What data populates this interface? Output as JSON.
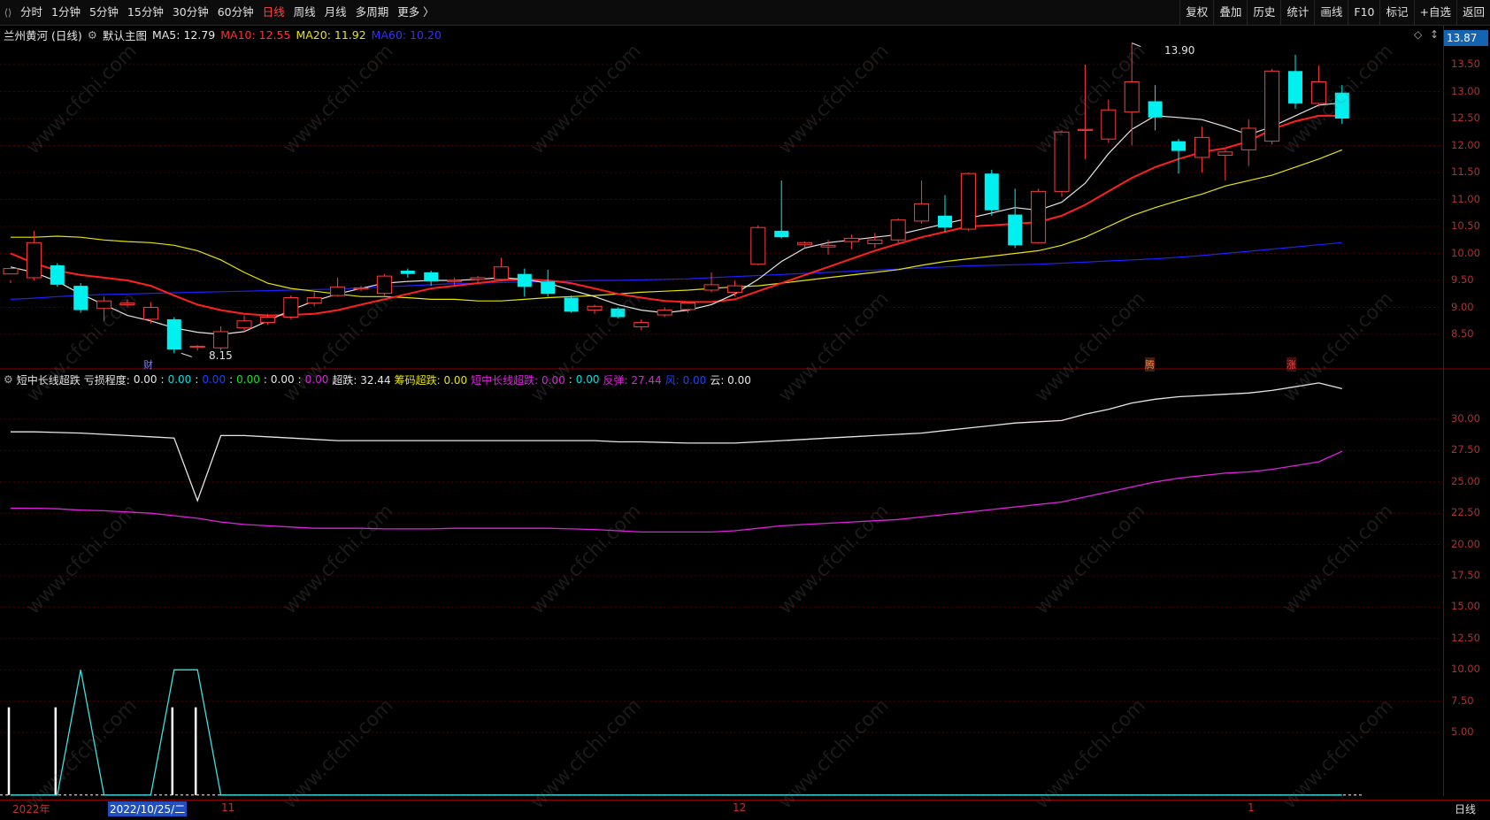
{
  "toolbar": {
    "items": [
      "分时",
      "1分钟",
      "5分钟",
      "15分钟",
      "30分钟",
      "60分钟",
      "日线",
      "周线",
      "月线",
      "多周期",
      "更多 〉"
    ],
    "active_index": 6,
    "right_items": [
      "复权",
      "叠加",
      "历史",
      "统计",
      "画线",
      "F10",
      "标记",
      "+自选",
      "返回"
    ]
  },
  "main_header": {
    "stock": "兰州黄河 (日线)",
    "template": "默认主图",
    "ma5": "MA5: 12.79",
    "ma10": "MA10: 12.55",
    "ma20": "MA20: 11.92",
    "ma60": "MA60: 10.20"
  },
  "price_tag": "13.87",
  "price_axis": [
    "13.50",
    "13.00",
    "12.50",
    "12.00",
    "11.50",
    "11.00",
    "10.50",
    "10.00",
    "9.50",
    "9.00",
    "8.50"
  ],
  "high_label": "13.90",
  "low_label": "8.15",
  "event_marks": [
    "财",
    "腾",
    "涨"
  ],
  "indicator_header": {
    "name": "短中长线超跌",
    "loss_label": "亏损程度:",
    "loss_values": [
      "0.00",
      "0.00",
      "0.00",
      "0.00",
      "0.00",
      "0.00"
    ],
    "chaodie": "超跌: 32.44",
    "chouma": "筹码超跌: 0.00",
    "dzcd": "短中长线超跌: 0.00",
    "dzcd_v2": "0.00",
    "fantan": "反弹: 27.44",
    "feng": "风: 0.00",
    "yun": "云: 0.00"
  },
  "ind_axis": [
    "30.00",
    "27.50",
    "25.00",
    "22.50",
    "20.00",
    "17.50",
    "15.00",
    "12.50",
    "10.00",
    "7.50",
    "5.00"
  ],
  "dates": {
    "year": "2022年",
    "selected": "2022/10/25/二",
    "m11": "11",
    "m12": "12",
    "m1": "1"
  },
  "period": "日线",
  "watermark": "www.cfchi.com",
  "colors": {
    "up": "#ff3c3c",
    "down": "#00f0f0",
    "ma5": "#e6e6e6",
    "ma10": "#ff2020",
    "ma20": "#e6e600",
    "ma60": "#2020ff"
  },
  "chart_data": {
    "type": "candlestick",
    "candles": [
      [
        9.62,
        9.72,
        9.5,
        9.45
      ],
      [
        9.55,
        10.2,
        10.42,
        9.5
      ],
      [
        9.78,
        9.42,
        9.82,
        9.38
      ],
      [
        9.4,
        8.95,
        9.45,
        8.9
      ],
      [
        8.98,
        9.12,
        9.2,
        8.75
      ],
      [
        9.05,
        9.08,
        9.15,
        9.0
      ],
      [
        8.78,
        9.0,
        9.1,
        8.7
      ],
      [
        8.78,
        8.22,
        8.82,
        8.15
      ],
      [
        8.26,
        8.28,
        8.3,
        8.2
      ],
      [
        8.25,
        8.55,
        8.65,
        8.2
      ],
      [
        8.62,
        8.75,
        8.85,
        8.55
      ],
      [
        8.72,
        8.82,
        8.88,
        8.68
      ],
      [
        8.82,
        9.18,
        9.22,
        8.78
      ],
      [
        9.08,
        9.18,
        9.28,
        9.02
      ],
      [
        9.22,
        9.38,
        9.55,
        9.2
      ],
      [
        9.34,
        9.36,
        9.4,
        9.3
      ],
      [
        9.26,
        9.58,
        9.62,
        9.22
      ],
      [
        9.68,
        9.62,
        9.72,
        9.55
      ],
      [
        9.65,
        9.48,
        9.68,
        9.4
      ],
      [
        9.48,
        9.5,
        9.55,
        9.4
      ],
      [
        9.52,
        9.55,
        9.58,
        9.45
      ],
      [
        9.52,
        9.75,
        9.92,
        9.5
      ],
      [
        9.62,
        9.38,
        9.72,
        9.2
      ],
      [
        9.48,
        9.25,
        9.7,
        9.2
      ],
      [
        9.18,
        8.92,
        9.22,
        8.9
      ],
      [
        8.95,
        9.02,
        9.05,
        8.88
      ],
      [
        8.98,
        8.82,
        9.0,
        8.8
      ],
      [
        8.64,
        8.72,
        8.78,
        8.58
      ],
      [
        8.86,
        8.95,
        9.0,
        8.82
      ],
      [
        8.96,
        9.08,
        9.1,
        8.9
      ],
      [
        9.32,
        9.42,
        9.65,
        9.28
      ],
      [
        9.28,
        9.4,
        9.5,
        9.2
      ],
      [
        9.8,
        10.48,
        10.52,
        9.78
      ],
      [
        10.42,
        10.3,
        11.35,
        10.28
      ],
      [
        10.16,
        10.2,
        10.22,
        10.1
      ],
      [
        10.12,
        10.15,
        10.25,
        9.98
      ],
      [
        10.22,
        10.28,
        10.35,
        10.08
      ],
      [
        10.18,
        10.25,
        10.38,
        10.1
      ],
      [
        10.25,
        10.62,
        10.65,
        10.2
      ],
      [
        10.6,
        10.92,
        11.35,
        10.55
      ],
      [
        10.7,
        10.48,
        11.08,
        10.4
      ],
      [
        10.45,
        11.48,
        11.5,
        10.42
      ],
      [
        11.48,
        10.8,
        11.55,
        10.7
      ],
      [
        10.72,
        10.15,
        11.2,
        10.1
      ],
      [
        10.2,
        11.15,
        11.2,
        10.18
      ],
      [
        11.15,
        12.25,
        12.28,
        11.05
      ],
      [
        12.28,
        12.3,
        13.5,
        11.75
      ],
      [
        12.12,
        12.66,
        12.85,
        12.05
      ],
      [
        12.62,
        13.18,
        13.9,
        12.0
      ],
      [
        12.82,
        12.52,
        13.12,
        12.28
      ],
      [
        12.08,
        11.9,
        12.12,
        11.48
      ],
      [
        11.78,
        12.15,
        12.35,
        11.5
      ],
      [
        11.82,
        11.88,
        11.92,
        11.35
      ],
      [
        11.92,
        12.32,
        12.48,
        11.62
      ],
      [
        12.08,
        13.38,
        13.42,
        12.02
      ],
      [
        13.38,
        12.78,
        13.68,
        12.68
      ],
      [
        12.78,
        13.18,
        13.48,
        12.72
      ],
      [
        12.98,
        12.5,
        13.12,
        12.4
      ]
    ],
    "ma5": [
      9.75,
      9.65,
      9.48,
      9.25,
      9.05,
      8.85,
      8.75,
      8.62,
      8.54,
      8.5,
      8.55,
      8.75,
      8.95,
      9.12,
      9.25,
      9.35,
      9.45,
      9.48,
      9.5,
      9.5,
      9.52,
      9.55,
      9.52,
      9.45,
      9.32,
      9.2,
      9.05,
      8.95,
      8.9,
      8.95,
      9.05,
      9.25,
      9.52,
      9.85,
      10.1,
      10.2,
      10.25,
      10.3,
      10.35,
      10.45,
      10.55,
      10.65,
      10.75,
      10.85,
      10.8,
      10.95,
      11.3,
      11.85,
      12.3,
      12.55,
      12.52,
      12.48,
      12.35,
      12.2,
      12.35,
      12.55,
      12.75,
      12.79
    ],
    "ma10": [
      10.0,
      9.82,
      9.68,
      9.6,
      9.55,
      9.5,
      9.4,
      9.22,
      9.05,
      8.95,
      8.88,
      8.85,
      8.86,
      8.88,
      8.95,
      9.05,
      9.15,
      9.25,
      9.35,
      9.4,
      9.45,
      9.5,
      9.52,
      9.5,
      9.45,
      9.35,
      9.25,
      9.18,
      9.12,
      9.1,
      9.1,
      9.15,
      9.3,
      9.45,
      9.6,
      9.75,
      9.9,
      10.05,
      10.18,
      10.3,
      10.4,
      10.5,
      10.52,
      10.55,
      10.58,
      10.7,
      10.9,
      11.15,
      11.4,
      11.6,
      11.75,
      11.88,
      11.95,
      12.08,
      12.3,
      12.45,
      12.55,
      12.55
    ],
    "ma20": [
      10.3,
      10.3,
      10.32,
      10.3,
      10.25,
      10.22,
      10.2,
      10.15,
      10.05,
      9.88,
      9.65,
      9.45,
      9.35,
      9.3,
      9.25,
      9.2,
      9.2,
      9.18,
      9.15,
      9.15,
      9.12,
      9.12,
      9.15,
      9.18,
      9.2,
      9.22,
      9.25,
      9.28,
      9.3,
      9.32,
      9.35,
      9.38,
      9.4,
      9.45,
      9.5,
      9.55,
      9.6,
      9.65,
      9.7,
      9.78,
      9.85,
      9.9,
      9.95,
      10.0,
      10.05,
      10.15,
      10.3,
      10.5,
      10.7,
      10.85,
      10.98,
      11.1,
      11.25,
      11.35,
      11.45,
      11.6,
      11.75,
      11.92
    ],
    "ma60": [
      9.15,
      9.17,
      9.2,
      9.22,
      9.24,
      9.25,
      9.26,
      9.27,
      9.28,
      9.29,
      9.3,
      9.31,
      9.32,
      9.33,
      9.34,
      9.36,
      9.38,
      9.4,
      9.42,
      9.44,
      9.45,
      9.46,
      9.47,
      9.48,
      9.49,
      9.5,
      9.5,
      9.51,
      9.52,
      9.53,
      9.55,
      9.57,
      9.59,
      9.61,
      9.63,
      9.65,
      9.67,
      9.69,
      9.71,
      9.73,
      9.75,
      9.77,
      9.78,
      9.79,
      9.8,
      9.82,
      9.84,
      9.86,
      9.88,
      9.9,
      9.93,
      9.96,
      10.0,
      10.04,
      10.08,
      10.12,
      10.16,
      10.2
    ],
    "chaodie": [
      29.0,
      29.0,
      28.95,
      28.9,
      28.8,
      28.7,
      28.6,
      28.5,
      23.5,
      28.7,
      28.7,
      28.6,
      28.5,
      28.4,
      28.3,
      28.3,
      28.3,
      28.3,
      28.3,
      28.3,
      28.3,
      28.3,
      28.3,
      28.3,
      28.3,
      28.3,
      28.2,
      28.2,
      28.15,
      28.1,
      28.1,
      28.1,
      28.2,
      28.3,
      28.4,
      28.5,
      28.6,
      28.7,
      28.8,
      28.9,
      29.1,
      29.3,
      29.5,
      29.7,
      29.8,
      29.9,
      30.4,
      30.8,
      31.3,
      31.6,
      31.8,
      31.9,
      32.0,
      32.1,
      32.3,
      32.6,
      32.9,
      32.44
    ],
    "fantan": [
      22.9,
      22.9,
      22.85,
      22.75,
      22.7,
      22.6,
      22.5,
      22.3,
      22.1,
      21.8,
      21.6,
      21.5,
      21.4,
      21.3,
      21.3,
      21.3,
      21.25,
      21.25,
      21.25,
      21.3,
      21.3,
      21.3,
      21.3,
      21.3,
      21.25,
      21.2,
      21.1,
      21.0,
      21.0,
      21.0,
      21.0,
      21.1,
      21.3,
      21.5,
      21.6,
      21.7,
      21.8,
      21.9,
      22.0,
      22.2,
      22.4,
      22.6,
      22.8,
      23.0,
      23.2,
      23.4,
      23.8,
      24.2,
      24.6,
      25.0,
      25.3,
      25.5,
      25.7,
      25.8,
      26.0,
      26.3,
      26.6,
      27.44
    ],
    "chouma_bars": [
      7.0,
      0,
      7.0,
      0,
      0,
      0,
      0,
      7.0,
      7.0,
      0,
      0,
      0,
      0,
      0,
      0,
      0,
      0,
      0,
      0,
      0,
      0,
      0,
      0,
      0,
      0,
      0,
      0,
      0,
      0,
      0,
      0,
      0,
      0,
      0,
      0,
      0,
      0,
      0,
      0,
      0,
      0,
      0,
      0,
      0,
      0,
      0,
      0,
      0,
      0,
      0,
      0,
      0,
      0,
      0,
      0,
      0,
      0,
      0
    ],
    "cyan_line": [
      0,
      0,
      0,
      10,
      0,
      0,
      0,
      10,
      10,
      0,
      0,
      0,
      0,
      0,
      0,
      0,
      0,
      0,
      0,
      0,
      0,
      0,
      0,
      0,
      0,
      0,
      0,
      0,
      0,
      0,
      0,
      0,
      0,
      0,
      0,
      0,
      0,
      0,
      0,
      0,
      0,
      0,
      0,
      0,
      0,
      0,
      0,
      0,
      0,
      0,
      0,
      0,
      0,
      0,
      0,
      0,
      0,
      0
    ]
  }
}
